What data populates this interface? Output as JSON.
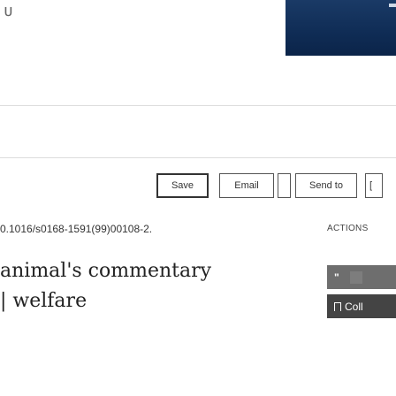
{
  "topbar": {
    "glyph": "ᴜ"
  },
  "toolbar": {
    "save_label": "Save",
    "email_label": "Email",
    "sendto_label": "Send to",
    "cut_label": "["
  },
  "article": {
    "doi": "0.1016/s0168-1591(99)00108-2.",
    "title_line1": "animal's commentary",
    "title_line2": "| welfare"
  },
  "actions": {
    "label": "ACTIONS",
    "cite_label": "\"",
    "collect_label": "Coll"
  }
}
